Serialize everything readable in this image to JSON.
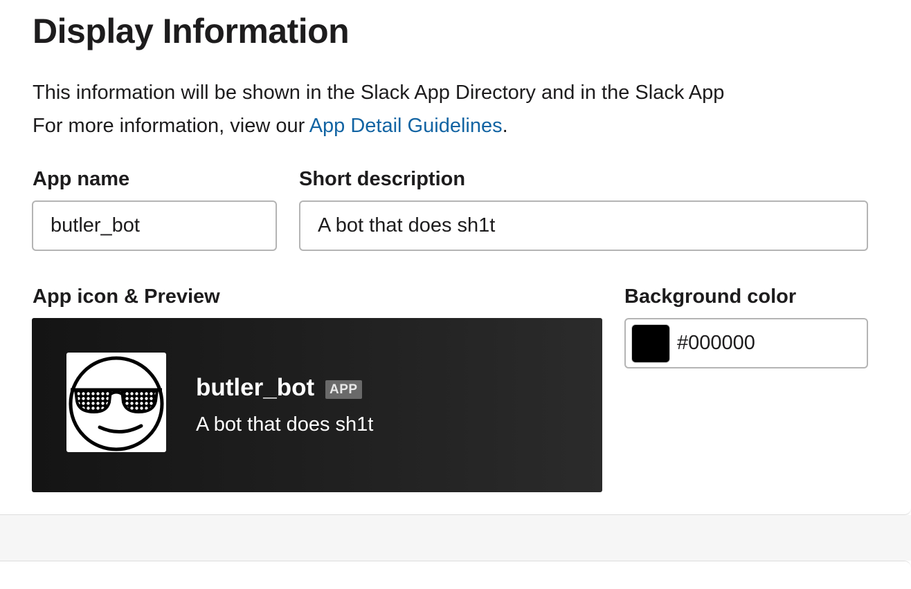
{
  "section": {
    "title": "Display Information",
    "description_line1": "This information will be shown in the Slack App Directory and in the Slack App",
    "description_line2_prefix": "For more information, view our ",
    "guidelines_link": "App Detail Guidelines",
    "description_line2_suffix": "."
  },
  "app_name": {
    "label": "App name",
    "value": "butler_bot"
  },
  "short_description": {
    "label": "Short description",
    "value": "A bot that does sh1t"
  },
  "preview": {
    "label": "App icon & Preview",
    "icon": "sunglasses-smiley-icon",
    "bot_name": "butler_bot",
    "badge": "APP",
    "bot_description": "A bot that does sh1t"
  },
  "background_color": {
    "label": "Background color",
    "value": "#000000",
    "swatch_color": "#000000"
  },
  "colors": {
    "link": "#1264a3",
    "preview_bg": "#1f1f1f"
  }
}
